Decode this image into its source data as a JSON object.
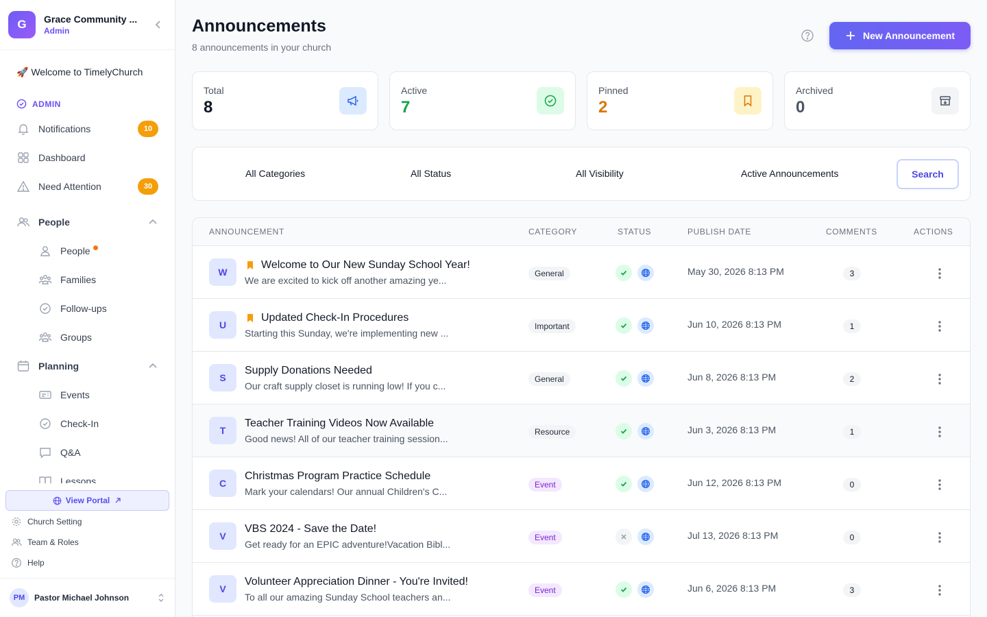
{
  "sidebar": {
    "org_initial": "G",
    "org_name": "Grace Community ...",
    "org_role": "Admin",
    "welcome": "🚀 Welcome to TimelyChurch",
    "section_admin": "ADMIN",
    "items": {
      "notifications": {
        "label": "Notifications",
        "badge": "10"
      },
      "dashboard": {
        "label": "Dashboard"
      },
      "need_attention": {
        "label": "Need Attention",
        "badge": "30"
      },
      "people_group": {
        "label": "People"
      },
      "people": {
        "label": "People"
      },
      "families": {
        "label": "Families"
      },
      "followups": {
        "label": "Follow-ups"
      },
      "groups": {
        "label": "Groups"
      },
      "planning_group": {
        "label": "Planning"
      },
      "events": {
        "label": "Events"
      },
      "checkin": {
        "label": "Check-In"
      },
      "qa": {
        "label": "Q&A"
      },
      "lessons": {
        "label": "Lessons"
      }
    },
    "view_portal": "View Portal",
    "church_setting": "Church Setting",
    "team_roles": "Team & Roles",
    "help": "Help",
    "user_initials": "PM",
    "user_name": "Pastor Michael Johnson"
  },
  "header": {
    "title": "Announcements",
    "subtitle": "8 announcements in your church",
    "new_button": "New Announcement"
  },
  "stats": [
    {
      "label": "Total",
      "value": "8",
      "color": "#111827",
      "icon": "megaphone-icon"
    },
    {
      "label": "Active",
      "value": "7",
      "color": "#16a34a",
      "icon": "check-circle-icon"
    },
    {
      "label": "Pinned",
      "value": "2",
      "color": "#d97706",
      "icon": "bookmark-icon"
    },
    {
      "label": "Archived",
      "value": "0",
      "color": "#4b5563",
      "icon": "archive-icon"
    }
  ],
  "filters": {
    "category": "All Categories",
    "status": "All Status",
    "visibility": "All Visibility",
    "scope": "Active Announcements",
    "search": "Search"
  },
  "table": {
    "columns": [
      "ANNOUNCEMENT",
      "CATEGORY",
      "STATUS",
      "PUBLISH DATE",
      "COMMENTS",
      "ACTIONS"
    ],
    "rows": [
      {
        "initial": "W",
        "title": "Welcome to Our New Sunday School Year!",
        "desc": "We are excited to kick off another amazing ye...",
        "category": "General",
        "pinned": true,
        "active": true,
        "date": "May 30, 2026 8:13 PM",
        "comments": "3"
      },
      {
        "initial": "U",
        "title": "Updated Check-In Procedures",
        "desc": "Starting this Sunday, we're implementing new ...",
        "category": "Important",
        "pinned": true,
        "active": true,
        "date": "Jun 10, 2026 8:13 PM",
        "comments": "1"
      },
      {
        "initial": "S",
        "title": "Supply Donations Needed",
        "desc": "Our craft supply closet is running low! If you c...",
        "category": "General",
        "pinned": false,
        "active": true,
        "date": "Jun 8, 2026 8:13 PM",
        "comments": "2"
      },
      {
        "initial": "T",
        "title": "Teacher Training Videos Now Available",
        "desc": "Good news! All of our teacher training session...",
        "category": "Resource",
        "pinned": false,
        "active": true,
        "date": "Jun 3, 2026 8:13 PM",
        "comments": "1"
      },
      {
        "initial": "C",
        "title": "Christmas Program Practice Schedule",
        "desc": "Mark your calendars! Our annual Children's C...",
        "category": "Event",
        "pinned": false,
        "active": true,
        "date": "Jun 12, 2026 8:13 PM",
        "comments": "0"
      },
      {
        "initial": "V",
        "title": "VBS 2024 - Save the Date!",
        "desc": "Get ready for an EPIC adventure!Vacation Bibl...",
        "category": "Event",
        "pinned": false,
        "active": false,
        "date": "Jul 13, 2026 8:13 PM",
        "comments": "0"
      },
      {
        "initial": "V",
        "title": "Volunteer Appreciation Dinner - You're Invited!",
        "desc": "To all our amazing Sunday School teachers an...",
        "category": "Event",
        "pinned": false,
        "active": true,
        "date": "Jun 6, 2026 8:13 PM",
        "comments": "3"
      }
    ]
  }
}
